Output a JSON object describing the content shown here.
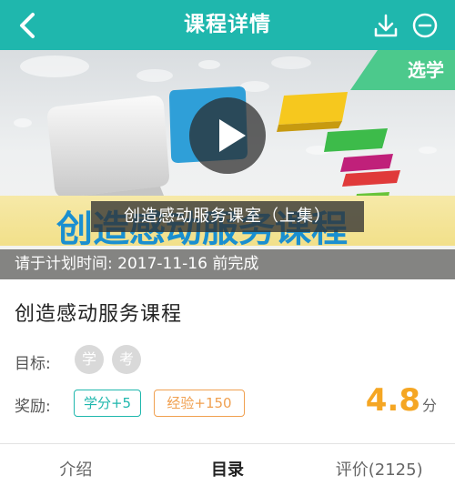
{
  "navbar": {
    "title": "课程详情",
    "back_icon": "chevron-left-icon",
    "download_icon": "download-icon",
    "minus_icon": "minus-circle-icon",
    "color": "#1fb7ad"
  },
  "banner": {
    "tag": "选学",
    "tag_color": "#4cc98c",
    "video_title": "创造感动服务课室（上集）",
    "deadline": "请于计划时间: 2017-11-16 前完成",
    "artwork_text": "创造感动服务课程"
  },
  "course": {
    "name": "创造感动服务课程",
    "goal_label": "目标:",
    "goal_badges": [
      "学",
      "考"
    ],
    "reward_label": "奖励:",
    "credit_tag": "学分+5",
    "exp_tag": "经验+150",
    "score": "4.8",
    "score_unit": "分",
    "accent": "#1fb7ad",
    "score_color": "#f5a623"
  },
  "tabs": [
    {
      "label": "介绍",
      "active": false
    },
    {
      "label": "目录",
      "active": true
    },
    {
      "label": "评价(2125)",
      "active": false
    }
  ]
}
